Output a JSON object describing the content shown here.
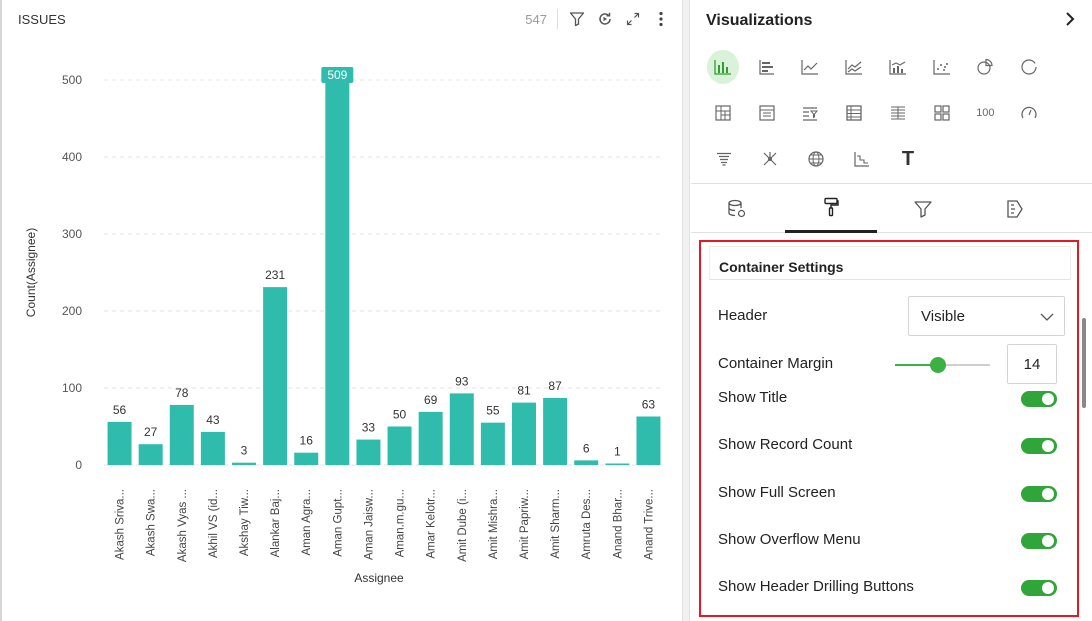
{
  "panel": {
    "title": "ISSUES",
    "record_count": "547",
    "toolbar_icons": [
      "filter-icon",
      "refresh-icon",
      "expand-icon",
      "more-vertical-icon"
    ]
  },
  "chart_data": {
    "type": "bar",
    "xlabel": "Assignee",
    "ylabel": "Count(Assignee)",
    "ylim": [
      0,
      500
    ],
    "yticks": [
      0,
      100,
      200,
      300,
      400,
      500
    ],
    "grid": true,
    "bar_color": "#2fbcad",
    "highlight_label_bg": "#2fbcad",
    "categories": [
      "Akash Sriva...",
      "Akash Swa...",
      "Akash Vyas ...",
      "Akhil VS (id...",
      "Akshay Tiw...",
      "Alankar Baj...",
      "Aman Agra...",
      "Aman Gupt...",
      "Aman Jaisw...",
      "Aman.m.gu...",
      "Amar Kelotr...",
      "Amit Dube (i...",
      "Amit Mishra...",
      "Amit Papriw...",
      "Amit Sharm...",
      "Amruta Des...",
      "Anand Bhar...",
      "Anand Trive..."
    ],
    "values": [
      56,
      27,
      78,
      43,
      3,
      231,
      16,
      509,
      33,
      50,
      69,
      93,
      55,
      81,
      87,
      6,
      1,
      63
    ],
    "highlighted_index": 7
  },
  "visualizations": {
    "title": "Visualizations",
    "icons": [
      [
        "bar-chart-icon",
        "horizontal-bar-icon",
        "line-chart-icon",
        "area-chart-icon",
        "combo-chart-icon",
        "scatter-chart-icon",
        "pie-chart-icon",
        "donut-chart-icon"
      ],
      [
        "pivot-table-icon",
        "list-table-icon",
        "filter-table-icon",
        "grid-table-icon",
        "detail-table-icon",
        "card-grid-icon",
        "kpi-number-icon",
        "gauge-icon"
      ],
      [
        "funnel-icon",
        "network-icon",
        "globe-map-icon",
        "step-chart-icon",
        "text-icon"
      ]
    ],
    "kpi_label": "100",
    "text_label": "T"
  },
  "tabs": [
    "data-source-icon",
    "format-paint-icon",
    "filter-icon",
    "drill-icon"
  ],
  "container_settings": {
    "title": "Container Settings",
    "header": {
      "label": "Header",
      "value": "Visible"
    },
    "margin": {
      "label": "Container Margin",
      "value": "14",
      "level_percent": 45
    },
    "toggles": [
      {
        "label": "Show Title",
        "on": true
      },
      {
        "label": "Show Record Count",
        "on": true
      },
      {
        "label": "Show Full Screen",
        "on": true
      },
      {
        "label": "Show Overflow Menu",
        "on": true
      },
      {
        "label": "Show Header Drilling Buttons",
        "on": true
      }
    ]
  },
  "colors": {
    "accent_green": "#2fa53a",
    "highlight_border": "#e01b24"
  }
}
